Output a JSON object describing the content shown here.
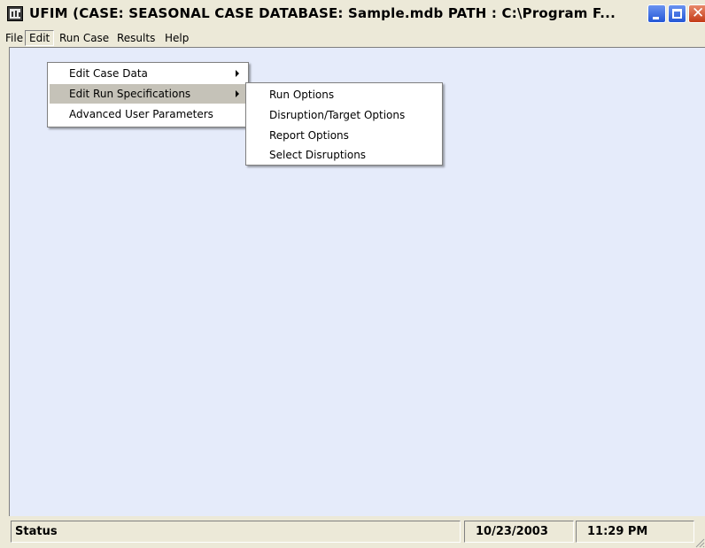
{
  "window": {
    "title": "UFIM (CASE: SEASONAL CASE   DATABASE: Sample.mdb   PATH : C:\\Program F...",
    "icon": "ufim-app-icon",
    "controls": {
      "minimize": "minimize-icon",
      "maximize": "maximize-icon",
      "close": "close-icon",
      "close_glyph": "✕"
    }
  },
  "menubar": {
    "items": [
      {
        "label": "File"
      },
      {
        "label": "Edit"
      },
      {
        "label": "Run Case"
      },
      {
        "label": "Results"
      },
      {
        "label": "Help"
      }
    ],
    "active": "Edit"
  },
  "edit_menu": {
    "items": [
      {
        "label": "Edit Case Data",
        "has_submenu": true
      },
      {
        "label": "Edit Run Specifications",
        "has_submenu": true
      },
      {
        "label": "Advanced User Parameters",
        "has_submenu": false
      }
    ],
    "highlighted": "Edit Run Specifications"
  },
  "run_spec_submenu": {
    "items": [
      {
        "label": "Run Options"
      },
      {
        "label": "Disruption/Target Options"
      },
      {
        "label": "Report Options"
      },
      {
        "label": "Select Disruptions"
      }
    ]
  },
  "statusbar": {
    "status": "Status",
    "date": "10/23/2003",
    "time": "11:29 PM"
  },
  "colors": {
    "client_bg": "#e5ebfa",
    "chrome_bg": "#ece9d8",
    "menu_highlight": "#c5c2b8"
  }
}
